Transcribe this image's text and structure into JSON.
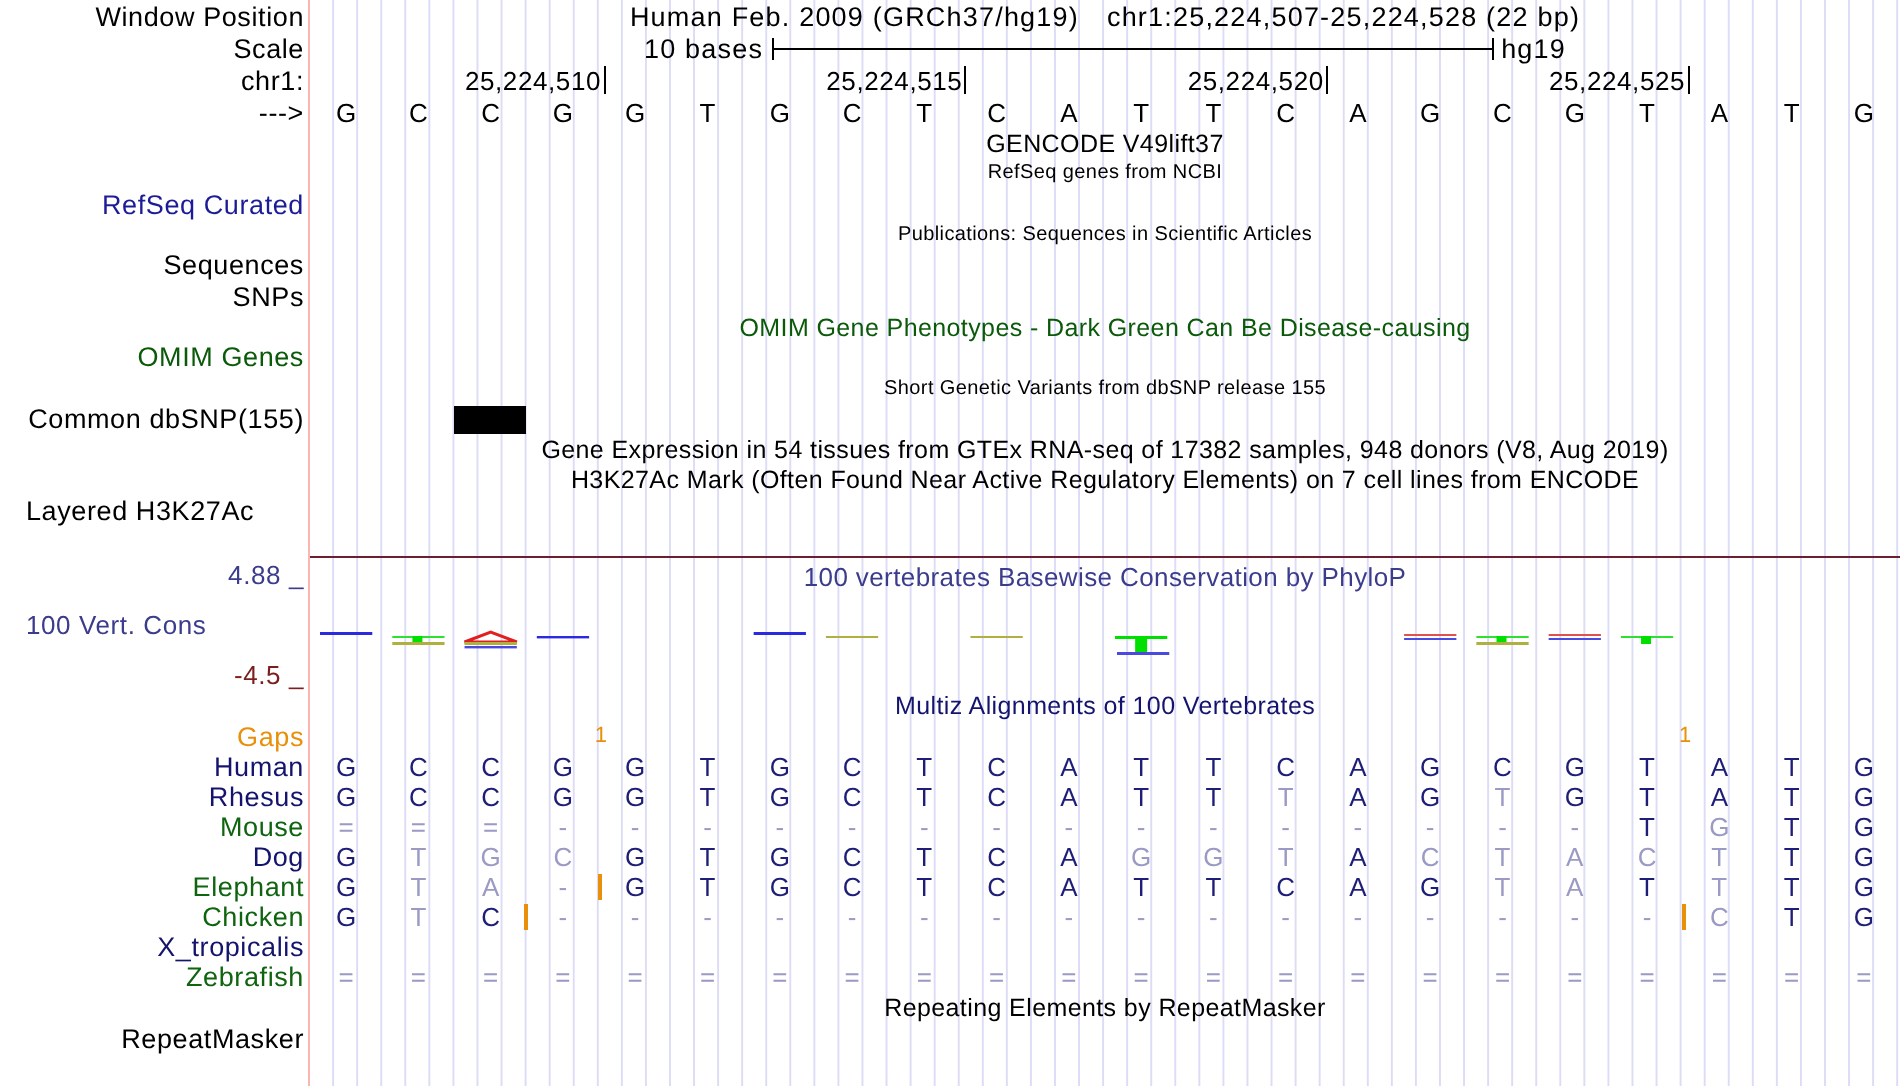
{
  "header": {
    "label": "Window Position",
    "assembly": "Human Feb. 2009 (GRCh37/hg19)",
    "position": "chr1:25,224,507-25,224,528 (22 bp)"
  },
  "scale": {
    "label": "Scale",
    "length": "10 bases",
    "assembly": "hg19"
  },
  "ruler": {
    "label": "chr1:",
    "positions": [
      {
        "kind": "plain"
      },
      {
        "kind": "plain"
      },
      {
        "kind": "plain"
      },
      {
        "kind": "tick",
        "tick": "25,224,510"
      },
      {
        "kind": "plain"
      },
      {
        "kind": "plain"
      },
      {
        "kind": "plain"
      },
      {
        "kind": "plain"
      },
      {
        "kind": "tick",
        "tick": "25,224,515"
      },
      {
        "kind": "plain"
      },
      {
        "kind": "plain"
      },
      {
        "kind": "plain"
      },
      {
        "kind": "plain"
      },
      {
        "kind": "tick",
        "tick": "25,224,520"
      },
      {
        "kind": "plain"
      },
      {
        "kind": "plain"
      },
      {
        "kind": "plain"
      },
      {
        "kind": "plain"
      },
      {
        "kind": "tick",
        "tick": "25,224,525"
      },
      {
        "kind": "plain"
      },
      {
        "kind": "plain"
      },
      {
        "kind": "plain"
      }
    ]
  },
  "sequence": {
    "label": "--->",
    "bases": [
      "G",
      "C",
      "C",
      "G",
      "G",
      "T",
      "G",
      "C",
      "T",
      "C",
      "A",
      "T",
      "T",
      "C",
      "A",
      "G",
      "C",
      "G",
      "T",
      "A",
      "T",
      "G"
    ]
  },
  "tracks": [
    {
      "kind": "title",
      "text": "GENCODE V49lift37",
      "color": "#000000"
    },
    {
      "kind": "subtitle",
      "text": "RefSeq genes from NCBI",
      "color": "#000000"
    },
    {
      "kind": "label",
      "text": "RefSeq Curated",
      "color": "#1c1c96"
    },
    {
      "kind": "subtitle",
      "text": "Publications: Sequences in Scientific Articles",
      "color": "#000000"
    },
    {
      "kind": "label",
      "text": "Sequences",
      "color": "#000000"
    },
    {
      "kind": "label",
      "text": "SNPs",
      "color": "#000000"
    },
    {
      "kind": "title",
      "text": "OMIM Gene Phenotypes - Dark Green Can Be Disease-causing",
      "color": "#0a5a0a"
    },
    {
      "kind": "label",
      "text": "OMIM Genes",
      "color": "#0a5a0a"
    },
    {
      "kind": "subtitle",
      "text": "Short Genetic Variants from dbSNP release 155",
      "color": "#000000"
    },
    {
      "kind": "variants",
      "text": "Common dbSNP(155)",
      "color": "#000000",
      "sites": [
        {
          "variant": false
        },
        {
          "variant": false
        },
        {
          "variant": true
        },
        {
          "variant": false
        },
        {
          "variant": false
        },
        {
          "variant": false
        },
        {
          "variant": false
        },
        {
          "variant": false
        },
        {
          "variant": false
        },
        {
          "variant": false
        },
        {
          "variant": false
        },
        {
          "variant": false
        },
        {
          "variant": false
        },
        {
          "variant": false
        },
        {
          "variant": false
        },
        {
          "variant": false
        },
        {
          "variant": false
        },
        {
          "variant": false
        },
        {
          "variant": false
        },
        {
          "variant": false
        },
        {
          "variant": false
        },
        {
          "variant": false
        }
      ]
    },
    {
      "kind": "title",
      "text": "Gene Expression in 54 tissues from GTEx RNA-seq of 17382 samples, 948 donors (V8, Aug 2019)",
      "color": "#000000"
    },
    {
      "kind": "title",
      "text": "H3K27Ac Mark (Often Found Near Active Regulatory Elements) on 7 cell lines from ENCODE",
      "color": "#000000"
    },
    {
      "kind": "composite_label",
      "text": "Layered H3K27Ac",
      "color": "#000000"
    }
  ],
  "conservation": {
    "title": "100 vertebrates Basewise Conservation by PhyloP",
    "label": "100 Vert. Cons",
    "max": "4.88 _",
    "min": "-4.5 _"
  },
  "alignment": {
    "title": "Multiz Alignments of 100 Vertebrates",
    "gaps_label": "Gaps",
    "gaps": [
      {
        "kind": "none"
      },
      {
        "kind": "none"
      },
      {
        "kind": "none"
      },
      {
        "kind": "count",
        "count": "1"
      },
      {
        "kind": "none"
      },
      {
        "kind": "none"
      },
      {
        "kind": "none"
      },
      {
        "kind": "none"
      },
      {
        "kind": "none"
      },
      {
        "kind": "none"
      },
      {
        "kind": "none"
      },
      {
        "kind": "none"
      },
      {
        "kind": "none"
      },
      {
        "kind": "none"
      },
      {
        "kind": "none"
      },
      {
        "kind": "none"
      },
      {
        "kind": "none"
      },
      {
        "kind": "none"
      },
      {
        "kind": "count",
        "count": "1"
      },
      {
        "kind": "none"
      },
      {
        "kind": "none"
      },
      {
        "kind": "none"
      }
    ],
    "species": [
      {
        "name": "Human",
        "color": "#14146e",
        "bases": [
          {
            "kind": "base",
            "base": "G",
            "dim": false
          },
          {
            "kind": "base",
            "base": "C",
            "dim": false
          },
          {
            "kind": "base",
            "base": "C",
            "dim": false
          },
          {
            "kind": "base",
            "base": "G",
            "dim": false
          },
          {
            "kind": "base",
            "base": "G",
            "dim": false
          },
          {
            "kind": "base",
            "base": "T",
            "dim": false
          },
          {
            "kind": "base",
            "base": "G",
            "dim": false
          },
          {
            "kind": "base",
            "base": "C",
            "dim": false
          },
          {
            "kind": "base",
            "base": "T",
            "dim": false
          },
          {
            "kind": "base",
            "base": "C",
            "dim": false
          },
          {
            "kind": "base",
            "base": "A",
            "dim": false
          },
          {
            "kind": "base",
            "base": "T",
            "dim": false
          },
          {
            "kind": "base",
            "base": "T",
            "dim": false
          },
          {
            "kind": "base",
            "base": "C",
            "dim": false
          },
          {
            "kind": "base",
            "base": "A",
            "dim": false
          },
          {
            "kind": "base",
            "base": "G",
            "dim": false
          },
          {
            "kind": "base",
            "base": "C",
            "dim": false
          },
          {
            "kind": "base",
            "base": "G",
            "dim": false
          },
          {
            "kind": "base",
            "base": "T",
            "dim": false
          },
          {
            "kind": "base",
            "base": "A",
            "dim": false
          },
          {
            "kind": "base",
            "base": "T",
            "dim": false
          },
          {
            "kind": "base",
            "base": "G",
            "dim": false
          }
        ]
      },
      {
        "name": "Rhesus",
        "color": "#14146e",
        "bases": [
          {
            "kind": "base",
            "base": "G",
            "dim": false
          },
          {
            "kind": "base",
            "base": "C",
            "dim": false
          },
          {
            "kind": "base",
            "base": "C",
            "dim": false
          },
          {
            "kind": "base",
            "base": "G",
            "dim": false
          },
          {
            "kind": "base",
            "base": "G",
            "dim": false
          },
          {
            "kind": "base",
            "base": "T",
            "dim": false
          },
          {
            "kind": "base",
            "base": "G",
            "dim": false
          },
          {
            "kind": "base",
            "base": "C",
            "dim": false
          },
          {
            "kind": "base",
            "base": "T",
            "dim": false
          },
          {
            "kind": "base",
            "base": "C",
            "dim": false
          },
          {
            "kind": "base",
            "base": "A",
            "dim": false
          },
          {
            "kind": "base",
            "base": "T",
            "dim": false
          },
          {
            "kind": "base",
            "base": "T",
            "dim": false
          },
          {
            "kind": "base",
            "base": "T",
            "dim": true
          },
          {
            "kind": "base",
            "base": "A",
            "dim": false
          },
          {
            "kind": "base",
            "base": "G",
            "dim": false
          },
          {
            "kind": "base",
            "base": "T",
            "dim": true
          },
          {
            "kind": "base",
            "base": "G",
            "dim": false
          },
          {
            "kind": "base",
            "base": "T",
            "dim": false
          },
          {
            "kind": "base",
            "base": "A",
            "dim": false
          },
          {
            "kind": "base",
            "base": "T",
            "dim": false
          },
          {
            "kind": "base",
            "base": "G",
            "dim": false
          }
        ]
      },
      {
        "name": "Mouse",
        "color": "#0f640f",
        "bases": [
          {
            "kind": "base",
            "base": "=",
            "dim": true
          },
          {
            "kind": "base",
            "base": "=",
            "dim": true
          },
          {
            "kind": "base",
            "base": "=",
            "dim": true
          },
          {
            "kind": "base",
            "base": "-",
            "dim": true
          },
          {
            "kind": "base",
            "base": "-",
            "dim": true
          },
          {
            "kind": "base",
            "base": "-",
            "dim": true
          },
          {
            "kind": "base",
            "base": "-",
            "dim": true
          },
          {
            "kind": "base",
            "base": "-",
            "dim": true
          },
          {
            "kind": "base",
            "base": "-",
            "dim": true
          },
          {
            "kind": "base",
            "base": "-",
            "dim": true
          },
          {
            "kind": "base",
            "base": "-",
            "dim": true
          },
          {
            "kind": "base",
            "base": "-",
            "dim": true
          },
          {
            "kind": "base",
            "base": "-",
            "dim": true
          },
          {
            "kind": "base",
            "base": "-",
            "dim": true
          },
          {
            "kind": "base",
            "base": "-",
            "dim": true
          },
          {
            "kind": "base",
            "base": "-",
            "dim": true
          },
          {
            "kind": "base",
            "base": "-",
            "dim": true
          },
          {
            "kind": "base",
            "base": "-",
            "dim": true
          },
          {
            "kind": "base",
            "base": "T",
            "dim": false
          },
          {
            "kind": "base",
            "base": "G",
            "dim": true
          },
          {
            "kind": "base",
            "base": "T",
            "dim": false
          },
          {
            "kind": "base",
            "base": "G",
            "dim": false
          }
        ]
      },
      {
        "name": "Dog",
        "color": "#14146e",
        "bases": [
          {
            "kind": "base",
            "base": "G",
            "dim": false
          },
          {
            "kind": "base",
            "base": "T",
            "dim": true
          },
          {
            "kind": "base",
            "base": "G",
            "dim": true
          },
          {
            "kind": "base",
            "base": "C",
            "dim": true
          },
          {
            "kind": "base",
            "base": "G",
            "dim": false
          },
          {
            "kind": "base",
            "base": "T",
            "dim": false
          },
          {
            "kind": "base",
            "base": "G",
            "dim": false
          },
          {
            "kind": "base",
            "base": "C",
            "dim": false
          },
          {
            "kind": "base",
            "base": "T",
            "dim": false
          },
          {
            "kind": "base",
            "base": "C",
            "dim": false
          },
          {
            "kind": "base",
            "base": "A",
            "dim": false
          },
          {
            "kind": "base",
            "base": "G",
            "dim": true
          },
          {
            "kind": "base",
            "base": "G",
            "dim": true
          },
          {
            "kind": "base",
            "base": "T",
            "dim": true
          },
          {
            "kind": "base",
            "base": "A",
            "dim": false
          },
          {
            "kind": "base",
            "base": "C",
            "dim": true
          },
          {
            "kind": "base",
            "base": "T",
            "dim": true
          },
          {
            "kind": "base",
            "base": "A",
            "dim": true
          },
          {
            "kind": "base",
            "base": "C",
            "dim": true
          },
          {
            "kind": "base",
            "base": "T",
            "dim": true
          },
          {
            "kind": "base",
            "base": "T",
            "dim": false
          },
          {
            "kind": "base",
            "base": "G",
            "dim": false
          }
        ]
      },
      {
        "name": "Elephant",
        "color": "#0f640f",
        "bases": [
          {
            "kind": "base",
            "base": "G",
            "dim": false
          },
          {
            "kind": "base",
            "base": "T",
            "dim": true
          },
          {
            "kind": "base",
            "base": "A",
            "dim": true
          },
          {
            "kind": "base",
            "base": "-",
            "dim": true
          },
          {
            "kind": "insertion"
          },
          {
            "kind": "base",
            "base": "G",
            "dim": false
          },
          {
            "kind": "base",
            "base": "T",
            "dim": false
          },
          {
            "kind": "base",
            "base": "G",
            "dim": false
          },
          {
            "kind": "base",
            "base": "C",
            "dim": false
          },
          {
            "kind": "base",
            "base": "T",
            "dim": false
          },
          {
            "kind": "base",
            "base": "C",
            "dim": false
          },
          {
            "kind": "base",
            "base": "A",
            "dim": false
          },
          {
            "kind": "base",
            "base": "T",
            "dim": false
          },
          {
            "kind": "base",
            "base": "T",
            "dim": false
          },
          {
            "kind": "base",
            "base": "C",
            "dim": false
          },
          {
            "kind": "base",
            "base": "A",
            "dim": false
          },
          {
            "kind": "base",
            "base": "G",
            "dim": false
          },
          {
            "kind": "base",
            "base": "T",
            "dim": true
          },
          {
            "kind": "base",
            "base": "A",
            "dim": true
          },
          {
            "kind": "base",
            "base": "T",
            "dim": false
          },
          {
            "kind": "base",
            "base": "T",
            "dim": true
          },
          {
            "kind": "base",
            "base": "T",
            "dim": false
          },
          {
            "kind": "base",
            "base": "G",
            "dim": false
          }
        ]
      },
      {
        "name": "Chicken",
        "color": "#0f640f",
        "bases": [
          {
            "kind": "base",
            "base": "G",
            "dim": false
          },
          {
            "kind": "base",
            "base": "T",
            "dim": true
          },
          {
            "kind": "base",
            "base": "C",
            "dim": false
          },
          {
            "kind": "insertion"
          },
          {
            "kind": "base",
            "base": "-",
            "dim": true
          },
          {
            "kind": "base",
            "base": "-",
            "dim": true
          },
          {
            "kind": "base",
            "base": "-",
            "dim": true
          },
          {
            "kind": "base",
            "base": "-",
            "dim": true
          },
          {
            "kind": "base",
            "base": "-",
            "dim": true
          },
          {
            "kind": "base",
            "base": "-",
            "dim": true
          },
          {
            "kind": "base",
            "base": "-",
            "dim": true
          },
          {
            "kind": "base",
            "base": "-",
            "dim": true
          },
          {
            "kind": "base",
            "base": "-",
            "dim": true
          },
          {
            "kind": "base",
            "base": "-",
            "dim": true
          },
          {
            "kind": "base",
            "base": "-",
            "dim": true
          },
          {
            "kind": "base",
            "base": "-",
            "dim": true
          },
          {
            "kind": "base",
            "base": "-",
            "dim": true
          },
          {
            "kind": "base",
            "base": "-",
            "dim": true
          },
          {
            "kind": "base",
            "base": "-",
            "dim": true
          },
          {
            "kind": "base",
            "base": "-",
            "dim": true
          },
          {
            "kind": "insertion"
          },
          {
            "kind": "base",
            "base": "C",
            "dim": true
          },
          {
            "kind": "base",
            "base": "T",
            "dim": false
          },
          {
            "kind": "base",
            "base": "G",
            "dim": false
          }
        ]
      },
      {
        "name": "X_tropicalis",
        "color": "#14146e"
      },
      {
        "name": "Zebrafish",
        "color": "#0f640f",
        "bases": [
          {
            "kind": "base",
            "base": "=",
            "dim": true
          },
          {
            "kind": "base",
            "base": "=",
            "dim": true
          },
          {
            "kind": "base",
            "base": "=",
            "dim": true
          },
          {
            "kind": "base",
            "base": "=",
            "dim": true
          },
          {
            "kind": "base",
            "base": "=",
            "dim": true
          },
          {
            "kind": "base",
            "base": "=",
            "dim": true
          },
          {
            "kind": "base",
            "base": "=",
            "dim": true
          },
          {
            "kind": "base",
            "base": "=",
            "dim": true
          },
          {
            "kind": "base",
            "base": "=",
            "dim": true
          },
          {
            "kind": "base",
            "base": "=",
            "dim": true
          },
          {
            "kind": "base",
            "base": "=",
            "dim": true
          },
          {
            "kind": "base",
            "base": "=",
            "dim": true
          },
          {
            "kind": "base",
            "base": "=",
            "dim": true
          },
          {
            "kind": "base",
            "base": "=",
            "dim": true
          },
          {
            "kind": "base",
            "base": "=",
            "dim": true
          },
          {
            "kind": "base",
            "base": "=",
            "dim": true
          },
          {
            "kind": "base",
            "base": "=",
            "dim": true
          },
          {
            "kind": "base",
            "base": "=",
            "dim": true
          },
          {
            "kind": "base",
            "base": "=",
            "dim": true
          },
          {
            "kind": "base",
            "base": "=",
            "dim": true
          },
          {
            "kind": "base",
            "base": "=",
            "dim": true
          },
          {
            "kind": "base",
            "base": "=",
            "dim": true
          }
        ]
      }
    ]
  },
  "repeats": {
    "title": "Repeating Elements by RepeatMasker",
    "label": "RepeatMasker"
  }
}
